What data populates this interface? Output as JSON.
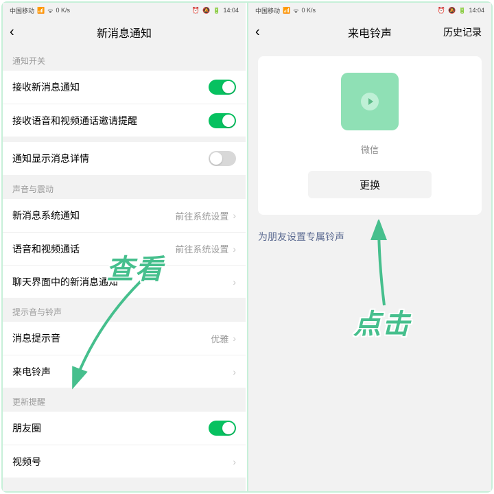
{
  "statusbar": {
    "carrier": "中国移动",
    "net_speed": "0 K/s",
    "time": "14:04"
  },
  "left": {
    "nav_title": "新消息通知",
    "section_switch": "通知开关",
    "row_receive": "接收新消息通知",
    "row_voice_invite": "接收语音和视频通话邀请提醒",
    "row_show_detail": "通知显示消息详情",
    "section_sound": "声音与震动",
    "row_sys_notify": "新消息系统通知",
    "row_sys_notify_val": "前往系统设置",
    "row_voip": "语音和视频通话",
    "row_voip_val": "前往系统设置",
    "row_chat_notify": "聊天界面中的新消息通知",
    "section_tone": "提示音与铃声",
    "row_tone": "消息提示音",
    "row_tone_val": "优雅",
    "row_ringtone": "来电铃声",
    "section_update": "更新提醒",
    "row_moments": "朋友圈",
    "row_channels": "视频号"
  },
  "right": {
    "nav_title": "来电铃声",
    "nav_action": "历史记录",
    "cover_label": "微信",
    "change_btn": "更换",
    "link": "为朋友设置专属铃声"
  },
  "callouts": {
    "look": "查看",
    "click": "点击"
  }
}
